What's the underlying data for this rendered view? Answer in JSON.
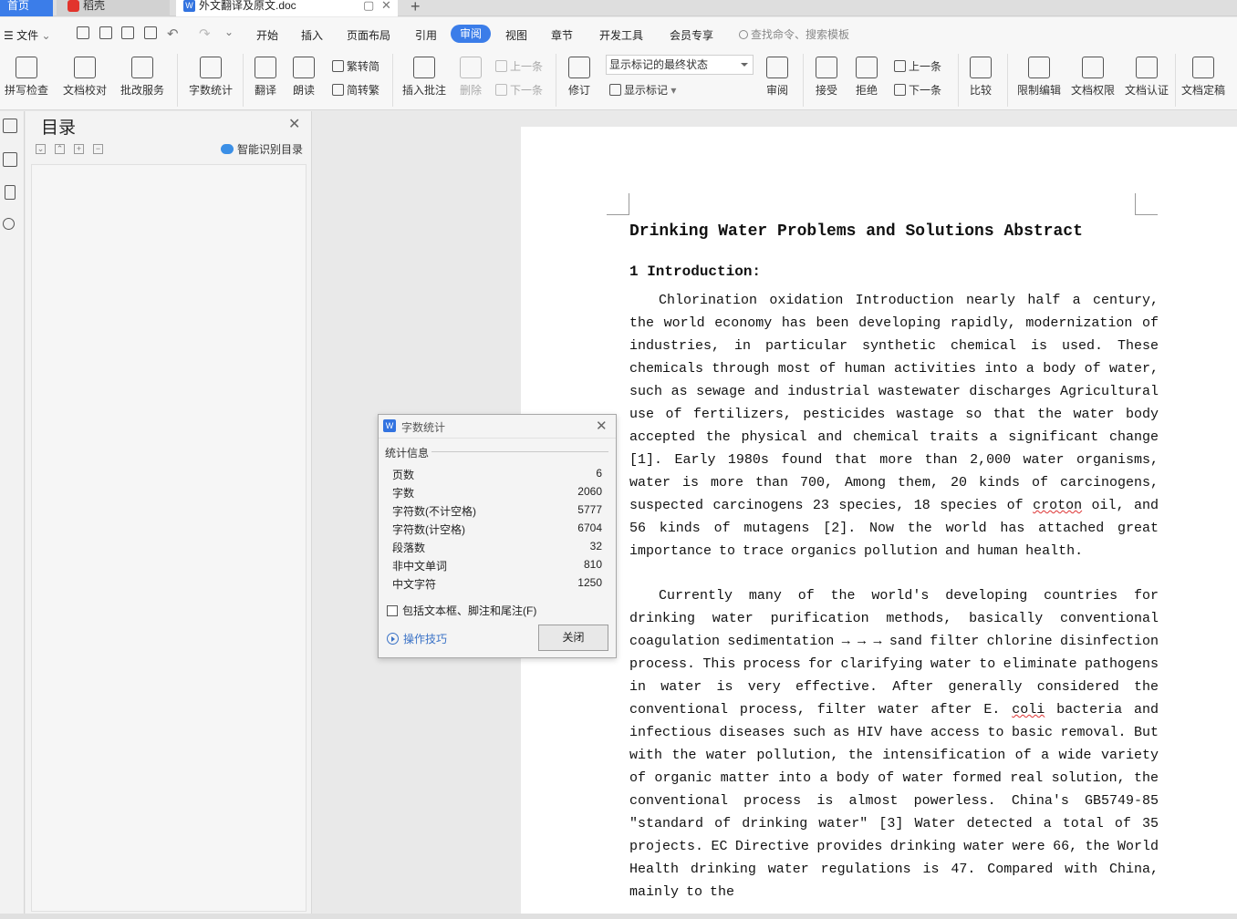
{
  "tabs": {
    "home": "首页",
    "shell": "稻壳",
    "doc": "外文翻译及原文.doc",
    "doc_icon": "W"
  },
  "menubar": {
    "file": "文件",
    "items": [
      "开始",
      "插入",
      "页面布局",
      "引用",
      "审阅",
      "视图",
      "章节",
      "开发工具",
      "会员专享"
    ],
    "active": "审阅",
    "search_placeholder": "查找命令、搜索模板"
  },
  "ribbon": {
    "spell_check": "拼写检查",
    "doc_proof": "文档校对",
    "review_service": "批改服务",
    "word_count": "字数统计",
    "translate": "翻译",
    "read_aloud": "朗读",
    "trad_to_simp": "繁转简",
    "simp_to_trad": "简转繁",
    "insert_comment": "插入批注",
    "delete": "删除",
    "prev_comment": "上一条",
    "next_comment": "下一条",
    "track_changes": "修订",
    "markup_mode": "显示标记的最终状态",
    "show_markup": "显示标记",
    "review": "审阅",
    "accept": "接受",
    "reject": "拒绝",
    "prev_change": "上一条",
    "next_change": "下一条",
    "compare": "比较",
    "restrict_edit": "限制编辑",
    "doc_permission": "文档权限",
    "doc_certify": "文档认证",
    "doc_finalize": "文档定稿",
    "accent_color": "#3b7de9"
  },
  "toc": {
    "title": "目录",
    "smart_recognize": "智能识别目录"
  },
  "document": {
    "title": "Drinking Water Problems and Solutions Abstract",
    "heading": "1 Introduction:",
    "p1_a": "Chlorination oxidation Introduction nearly half a century, the world economy has been developing rapidly, modernization of industries, in particular synthetic chemical is used. These chemicals through most of human activities into a body of water, such as sewage and industrial wastewater discharges Agricultural use of fertilizers, pesticides wastage so that the water body accepted the physical and chemical traits a significant change [1]. Early 1980s found that more than 2,000 water organisms, water is more than 700, Among them, 20 kinds of carcinogens, suspected carcinogens 23 species, 18 species of ",
    "p1_wavy": "croton",
    "p1_b": " oil, and 56 kinds of mutagens [2]. Now the world has attached great importance to trace organics pollution and human health.",
    "p2_a": "Currently many of the world's developing countries for drinking water purification methods, basically conventional coagulation sedimentation → → → sand filter chlorine disinfection process. This process for clarifying water to eliminate pathogens in water is very effective. After generally considered the conventional process, filter water after E. ",
    "p2_wavy": "coli",
    "p2_b": " bacteria and infectious diseases such as HIV have access to basic removal. But with the water pollution, the intensification of a wide variety of organic matter into a body of water formed real solution, the conventional process is almost powerless. China's GB5749-85 \"standard of drinking water\" [3] Water detected a total of 35 projects. EC Directive provides drinking water were 66, the World Health drinking water regulations is 47. Compared with China, mainly to the"
  },
  "dialog": {
    "title": "字数统计",
    "icon": "W",
    "group": "统计信息",
    "stats": [
      {
        "label": "页数",
        "value": "6"
      },
      {
        "label": "字数",
        "value": "2060"
      },
      {
        "label": "字符数(不计空格)",
        "value": "5777"
      },
      {
        "label": "字符数(计空格)",
        "value": "6704"
      },
      {
        "label": "段落数",
        "value": "32"
      },
      {
        "label": "非中文单词",
        "value": "810"
      },
      {
        "label": "中文字符",
        "value": "1250"
      }
    ],
    "include_label": "包括文本框、脚注和尾注(F)",
    "tips": "操作技巧",
    "close": "关闭"
  }
}
